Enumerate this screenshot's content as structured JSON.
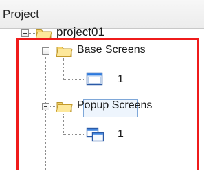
{
  "panel": {
    "title": "Project"
  },
  "tree": {
    "root": {
      "label": "project01",
      "icon": "folder-icon"
    },
    "base_screens": {
      "label": "Base Screens",
      "icon": "folder-icon",
      "children": [
        {
          "label": "1",
          "icon": "window-screen-icon",
          "selected": true
        }
      ]
    },
    "popup_screens": {
      "label": "Popup Screens",
      "icon": "folder-icon",
      "children": [
        {
          "label": "1",
          "icon": "popup-screen-icon"
        }
      ]
    }
  },
  "colors": {
    "highlight": "#ef1b1b",
    "folder_fill": "#f6d36b",
    "folder_stroke": "#b8952f",
    "selection": "#eef5fd"
  }
}
